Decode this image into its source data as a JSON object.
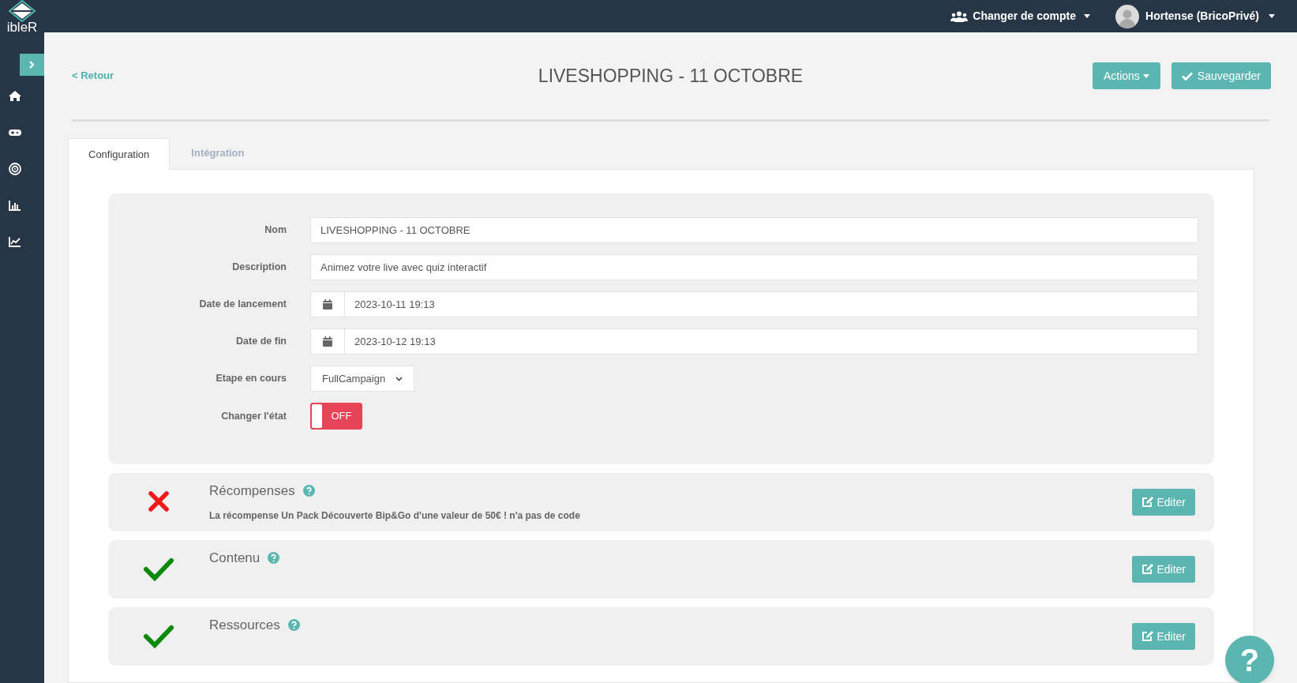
{
  "logo": {
    "text": "ibleR"
  },
  "sidebar": {
    "items": [
      {
        "kind": "home"
      },
      {
        "kind": "gamepad"
      },
      {
        "kind": "target"
      },
      {
        "kind": "bar-chart"
      },
      {
        "kind": "line-chart"
      }
    ]
  },
  "topbar": {
    "switch_account": "Changer de compte",
    "user": "Hortense (BricoPrivé)"
  },
  "back_link": "< Retour",
  "title": "LIVESHOPPING - 11 OCTOBRE",
  "actions": {
    "menu": "Actions",
    "save": "Sauvegarder"
  },
  "tabs": [
    {
      "label": "Configuration",
      "selected": true
    },
    {
      "label": "Intégration",
      "selected": false
    }
  ],
  "form": {
    "fields": [
      {
        "kind": "text",
        "label": "Nom",
        "value": "LIVESHOPPING - 11 OCTOBRE"
      },
      {
        "kind": "text",
        "label": "Description",
        "value": "Animez votre live avec quiz interactif"
      },
      {
        "kind": "date",
        "label": "Date de lancement",
        "value": "2023-10-11 19:13"
      },
      {
        "kind": "date",
        "label": "Date de fin",
        "value": "2023-10-12 19:13"
      },
      {
        "kind": "select",
        "label": "Etape en cours",
        "value": "FullCampaign"
      },
      {
        "kind": "toggle",
        "label": "Changer l'état",
        "on": false,
        "value": "OFF"
      }
    ]
  },
  "sections": [
    {
      "title": "Récompenses",
      "valid": false,
      "message": "La récompense Un Pack Découverte Bip&Go d'une valeur de 50€ ! n'a pas de code",
      "button": "Editer"
    },
    {
      "title": "Contenu",
      "valid": true,
      "button": "Editer"
    },
    {
      "title": "Ressources",
      "valid": true,
      "button": "Editer"
    }
  ],
  "help_button": "?"
}
